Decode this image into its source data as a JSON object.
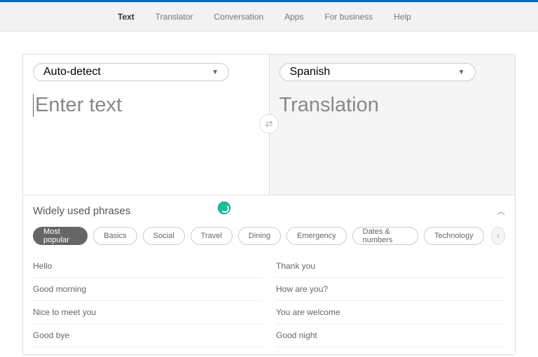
{
  "nav": {
    "text": "Text",
    "translator": "Translator",
    "conversation": "Conversation",
    "apps": "Apps",
    "business": "For business",
    "help": "Help"
  },
  "source": {
    "lang": "Auto-detect",
    "placeholder": "Enter text"
  },
  "target": {
    "lang": "Spanish",
    "placeholder": "Translation"
  },
  "phrases": {
    "title": "Widely used phrases",
    "chips": {
      "most_popular": "Most popular",
      "basics": "Basics",
      "social": "Social",
      "travel": "Travel",
      "dining": "Dining",
      "emergency": "Emergency",
      "dates": "Dates & numbers",
      "technology": "Technology"
    },
    "left": {
      "p0": "Hello",
      "p1": "Good morning",
      "p2": "Nice to meet you",
      "p3": "Good bye"
    },
    "right": {
      "p0": "Thank you",
      "p1": "How are you?",
      "p2": "You are welcome",
      "p3": "Good night"
    }
  }
}
